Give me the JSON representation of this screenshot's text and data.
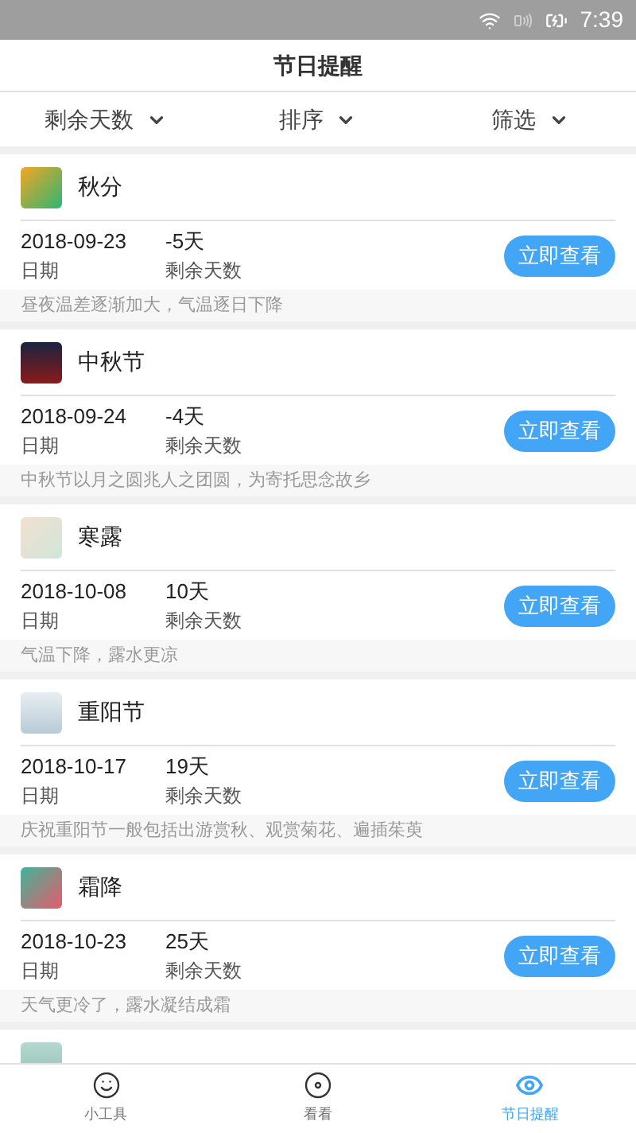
{
  "status_bar": {
    "time": "7:39"
  },
  "header": {
    "title": "节日提醒"
  },
  "filters": [
    {
      "label": "剩余天数"
    },
    {
      "label": "排序"
    },
    {
      "label": "筛选"
    }
  ],
  "festivals": [
    {
      "name": "秋分",
      "date": "2018-09-23",
      "date_label": "日期",
      "days": "-5天",
      "days_label": "剩余天数",
      "button": "立即查看",
      "description": "昼夜温差逐渐加大，气温逐日下降"
    },
    {
      "name": "中秋节",
      "date": "2018-09-24",
      "date_label": "日期",
      "days": "-4天",
      "days_label": "剩余天数",
      "button": "立即查看",
      "description": "中秋节以月之圆兆人之团圆，为寄托思念故乡"
    },
    {
      "name": "寒露",
      "date": "2018-10-08",
      "date_label": "日期",
      "days": "10天",
      "days_label": "剩余天数",
      "button": "立即查看",
      "description": "气温下降，露水更凉"
    },
    {
      "name": "重阳节",
      "date": "2018-10-17",
      "date_label": "日期",
      "days": "19天",
      "days_label": "剩余天数",
      "button": "立即查看",
      "description": "庆祝重阳节一般包括出游赏秋、观赏菊花、遍插茱萸"
    },
    {
      "name": "霜降",
      "date": "2018-10-23",
      "date_label": "日期",
      "days": "25天",
      "days_label": "剩余天数",
      "button": "立即查看",
      "description": "天气更冷了，露水凝结成霜"
    }
  ],
  "tab_bar": [
    {
      "label": "小工具",
      "kind": "smile",
      "selected": false
    },
    {
      "label": "看看",
      "kind": "disc",
      "selected": false
    },
    {
      "label": "节日提醒",
      "kind": "eye",
      "selected": true
    }
  ]
}
